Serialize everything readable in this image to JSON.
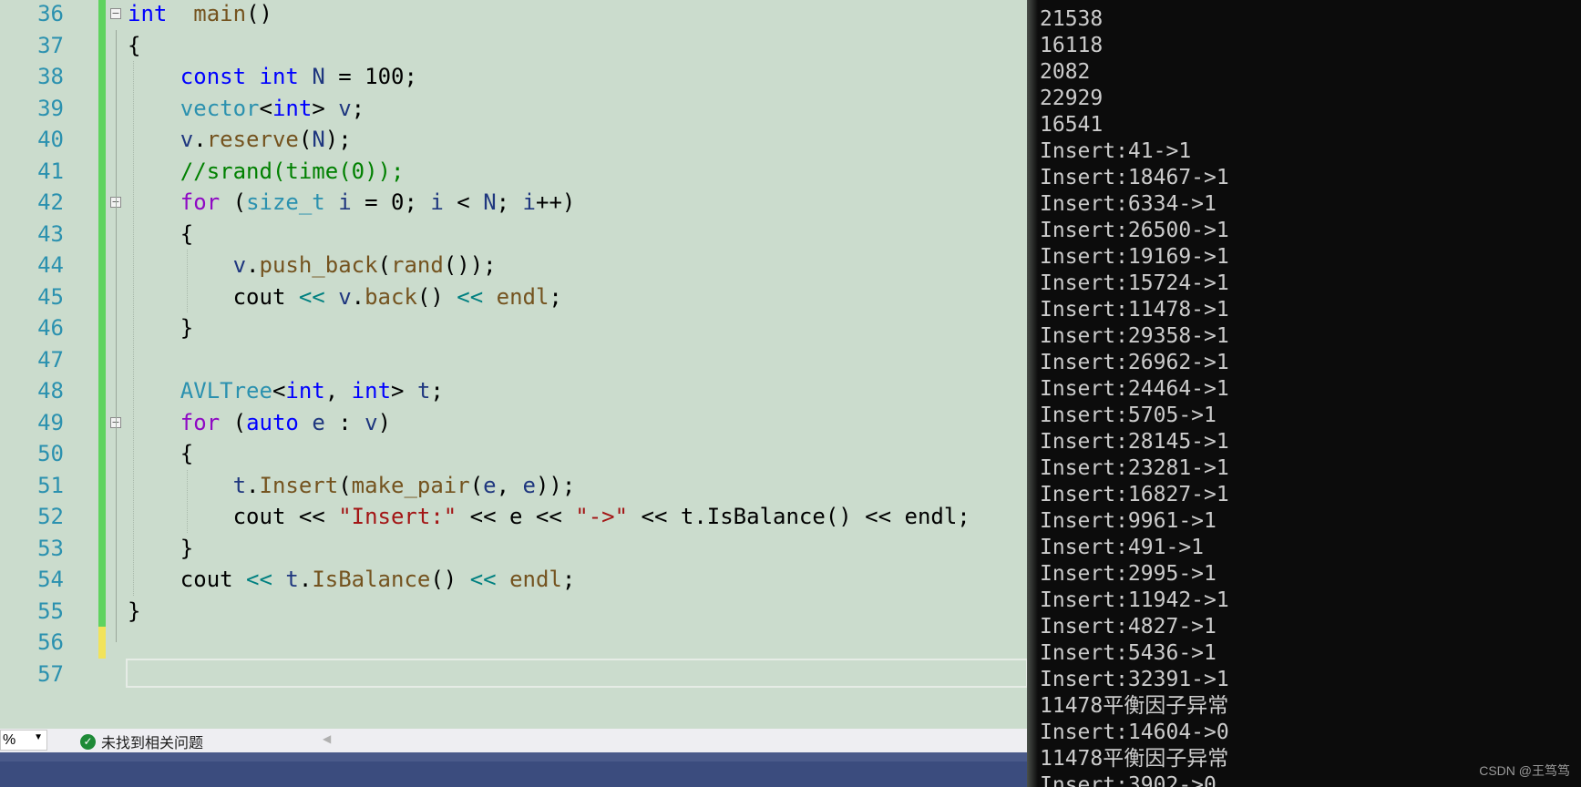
{
  "editor": {
    "lines": [
      {
        "n": "36",
        "t": [
          [
            "kw",
            "int"
          ],
          [
            "",
            "  "
          ],
          [
            "fn",
            "main"
          ],
          [
            "",
            "()"
          ]
        ]
      },
      {
        "n": "37",
        "t": [
          [
            "",
            "{"
          ]
        ]
      },
      {
        "n": "38",
        "t": [
          [
            "",
            "    "
          ],
          [
            "kw",
            "const"
          ],
          [
            "",
            " "
          ],
          [
            "kw",
            "int"
          ],
          [
            "",
            " "
          ],
          [
            "var",
            "N"
          ],
          [
            "",
            " = 100;"
          ]
        ]
      },
      {
        "n": "39",
        "t": [
          [
            "",
            "    "
          ],
          [
            "ty",
            "vector"
          ],
          [
            "",
            "<"
          ],
          [
            "kw",
            "int"
          ],
          [
            "",
            "> "
          ],
          [
            "var",
            "v"
          ],
          [
            "",
            ";"
          ]
        ]
      },
      {
        "n": "40",
        "t": [
          [
            "",
            "    "
          ],
          [
            "var",
            "v"
          ],
          [
            "",
            "."
          ],
          [
            "fn",
            "reserve"
          ],
          [
            "",
            "("
          ],
          [
            "var",
            "N"
          ],
          [
            "",
            ");"
          ]
        ]
      },
      {
        "n": "41",
        "t": [
          [
            "",
            "    "
          ],
          [
            "cm",
            "//srand(time(0));"
          ]
        ]
      },
      {
        "n": "42",
        "t": [
          [
            "",
            "    "
          ],
          [
            "ctl",
            "for"
          ],
          [
            "",
            " ("
          ],
          [
            "ty",
            "size_t"
          ],
          [
            "",
            " "
          ],
          [
            "var",
            "i"
          ],
          [
            "",
            " = 0; "
          ],
          [
            "var",
            "i"
          ],
          [
            "",
            " < "
          ],
          [
            "var",
            "N"
          ],
          [
            "",
            "; "
          ],
          [
            "var",
            "i"
          ],
          [
            "",
            "++)"
          ]
        ]
      },
      {
        "n": "43",
        "t": [
          [
            "",
            "    {"
          ]
        ]
      },
      {
        "n": "44",
        "t": [
          [
            "",
            "        "
          ],
          [
            "var",
            "v"
          ],
          [
            "",
            "."
          ],
          [
            "fn",
            "push_back"
          ],
          [
            "",
            "("
          ],
          [
            "fn",
            "rand"
          ],
          [
            "",
            "());"
          ]
        ]
      },
      {
        "n": "45",
        "t": [
          [
            "",
            "        cout "
          ],
          [
            "op",
            "<<"
          ],
          [
            "",
            " "
          ],
          [
            "var",
            "v"
          ],
          [
            "",
            "."
          ],
          [
            "fn",
            "back"
          ],
          [
            "",
            "() "
          ],
          [
            "op",
            "<<"
          ],
          [
            "",
            " "
          ],
          [
            "fn",
            "endl"
          ],
          [
            "",
            ";"
          ]
        ]
      },
      {
        "n": "46",
        "t": [
          [
            "",
            "    }"
          ]
        ]
      },
      {
        "n": "47",
        "t": [
          [
            "",
            ""
          ]
        ]
      },
      {
        "n": "48",
        "t": [
          [
            "",
            "    "
          ],
          [
            "ty",
            "AVLTree"
          ],
          [
            "",
            "<"
          ],
          [
            "kw",
            "int"
          ],
          [
            "",
            ", "
          ],
          [
            "kw",
            "int"
          ],
          [
            "",
            "> "
          ],
          [
            "var",
            "t"
          ],
          [
            "",
            ";"
          ]
        ]
      },
      {
        "n": "49",
        "t": [
          [
            "",
            "    "
          ],
          [
            "ctl",
            "for"
          ],
          [
            "",
            " ("
          ],
          [
            "kw",
            "auto"
          ],
          [
            "",
            " "
          ],
          [
            "var",
            "e"
          ],
          [
            "",
            " : "
          ],
          [
            "var",
            "v"
          ],
          [
            "",
            ")"
          ]
        ]
      },
      {
        "n": "50",
        "t": [
          [
            "",
            "    {"
          ]
        ]
      },
      {
        "n": "51",
        "t": [
          [
            "",
            "        "
          ],
          [
            "var",
            "t"
          ],
          [
            "",
            "."
          ],
          [
            "fn",
            "Insert"
          ],
          [
            "",
            "("
          ],
          [
            "fn",
            "make_pair"
          ],
          [
            "",
            "("
          ],
          [
            "var",
            "e"
          ],
          [
            "",
            ", "
          ],
          [
            "var",
            "e"
          ],
          [
            "",
            "));"
          ]
        ]
      },
      {
        "n": "52",
        "t": [
          [
            "",
            "        cout << "
          ],
          [
            "str",
            "\"Insert:\""
          ],
          [
            "",
            " << e << "
          ],
          [
            "str",
            "\"->\""
          ],
          [
            "",
            " << t.IsBalance() << endl;"
          ]
        ]
      },
      {
        "n": "53",
        "t": [
          [
            "",
            "    }"
          ]
        ]
      },
      {
        "n": "54",
        "t": [
          [
            "",
            "    cout "
          ],
          [
            "op",
            "<<"
          ],
          [
            "",
            " "
          ],
          [
            "var",
            "t"
          ],
          [
            "",
            "."
          ],
          [
            "fn",
            "IsBalance"
          ],
          [
            "",
            "() "
          ],
          [
            "op",
            "<<"
          ],
          [
            "",
            " "
          ],
          [
            "fn",
            "endl"
          ],
          [
            "",
            ";"
          ]
        ]
      },
      {
        "n": "55",
        "t": [
          [
            "",
            "}"
          ]
        ]
      },
      {
        "n": "56",
        "t": [
          [
            "",
            ""
          ]
        ]
      },
      {
        "n": "57",
        "t": [
          [
            "",
            ""
          ]
        ]
      }
    ]
  },
  "statusbar": {
    "zoom_value": "%",
    "zoom_dropdown_icon": "chevron-down-icon",
    "issues_icon": "check-circle-icon",
    "issues_text": "未找到相关问题"
  },
  "console": {
    "lines": [
      "21538",
      "16118",
      "2082",
      "22929",
      "16541",
      "Insert:41->1",
      "Insert:18467->1",
      "Insert:6334->1",
      "Insert:26500->1",
      "Insert:19169->1",
      "Insert:15724->1",
      "Insert:11478->1",
      "Insert:29358->1",
      "Insert:26962->1",
      "Insert:24464->1",
      "Insert:5705->1",
      "Insert:28145->1",
      "Insert:23281->1",
      "Insert:16827->1",
      "Insert:9961->1",
      "Insert:491->1",
      "Insert:2995->1",
      "Insert:11942->1",
      "Insert:4827->1",
      "Insert:5436->1",
      "Insert:32391->1",
      "11478平衡因子异常",
      "Insert:14604->0",
      "11478平衡因子异常",
      "Insert:3902->0"
    ]
  },
  "watermark": "CSDN @王笃笃",
  "colors": {
    "editor_bg": "#cbdccd",
    "console_bg": "#0c0c0c",
    "change_bar_saved": "#5fd35f",
    "change_bar_unsaved": "#f2e35a",
    "statusbar_bg": "#3b4c7e"
  }
}
